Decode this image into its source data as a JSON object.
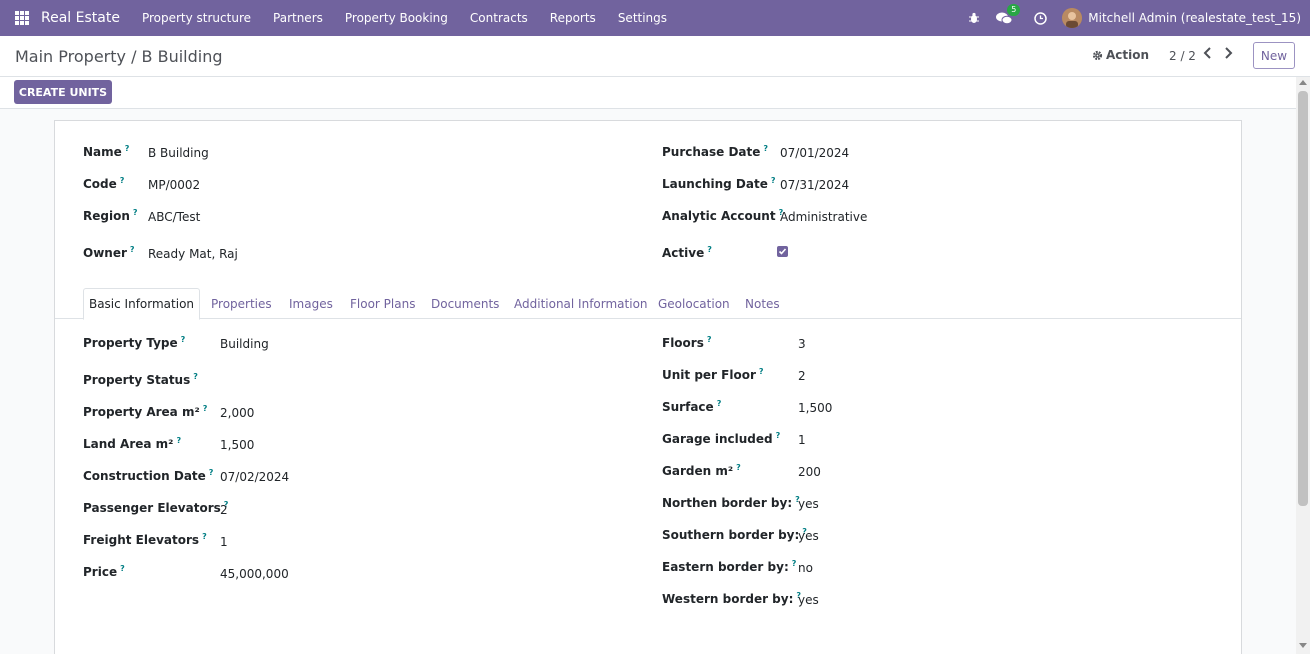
{
  "navbar": {
    "brand": "Real Estate",
    "menu": [
      "Property structure",
      "Partners",
      "Property Booking",
      "Contracts",
      "Reports",
      "Settings"
    ],
    "messages_count": "5",
    "user": "Mitchell Admin (realestate_test_15)",
    "icons": [
      "apps-grid-icon",
      "bug-icon",
      "chat-icon",
      "clock-icon"
    ]
  },
  "control": {
    "breadcrumb": "Main Property / B Building",
    "action_label": "Action",
    "pager": "2 / 2",
    "new_label": "New"
  },
  "statusbar": {
    "create_units_label": "CREATE UNITS"
  },
  "header_fields": {
    "left": [
      {
        "label": "Name",
        "value": "B Building"
      },
      {
        "label": "Code",
        "value": "MP/0002"
      },
      {
        "label": "Region",
        "value": "ABC/Test"
      },
      {
        "label": "Owner",
        "value": "Ready Mat, Raj"
      }
    ],
    "right": [
      {
        "label": "Purchase Date",
        "value": "07/01/2024"
      },
      {
        "label": "Launching Date",
        "value": "07/31/2024"
      },
      {
        "label": "Analytic Account",
        "value": "Administrative"
      },
      {
        "label": "Active",
        "checked": true
      }
    ]
  },
  "tabs": [
    "Basic Information",
    "Properties",
    "Images",
    "Floor Plans",
    "Documents",
    "Additional Information",
    "Geolocation",
    "Notes"
  ],
  "active_tab": "Basic Information",
  "basic_info": {
    "left": [
      {
        "label": "Property Type",
        "value": "Building"
      },
      {
        "label": "Property Status",
        "value": ""
      },
      {
        "label": "Property Area m²",
        "value": "2,000"
      },
      {
        "label": "Land Area m²",
        "value": "1,500"
      },
      {
        "label": "Construction Date",
        "value": "07/02/2024"
      },
      {
        "label": "Passenger Elevators",
        "value": "2"
      },
      {
        "label": "Freight Elevators",
        "value": "1"
      },
      {
        "label": "Price",
        "value": "45,000,000"
      }
    ],
    "right": [
      {
        "label": "Floors",
        "value": "3"
      },
      {
        "label": "Unit per Floor",
        "value": "2"
      },
      {
        "label": "Surface",
        "value": "1,500"
      },
      {
        "label": "Garage included",
        "value": "1"
      },
      {
        "label": "Garden m²",
        "value": "200"
      },
      {
        "label": "Northen border by:",
        "value": "yes"
      },
      {
        "label": "Southern border by:",
        "value": "yes"
      },
      {
        "label": "Eastern border by:",
        "value": "no"
      },
      {
        "label": "Western border by:",
        "value": "yes"
      }
    ]
  },
  "help_mark": "?",
  "colors": {
    "navbar": "#71639e",
    "primary": "#71639e",
    "help": "#017e84",
    "badge": "#28a745"
  }
}
